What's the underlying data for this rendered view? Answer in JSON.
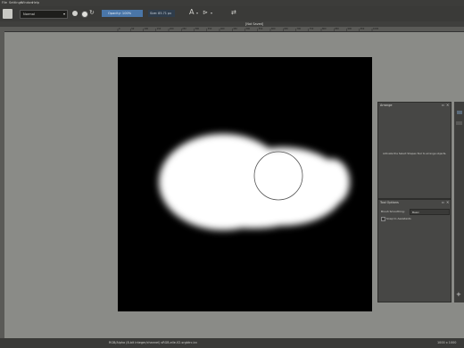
{
  "menubar": {
    "items": [
      "File",
      "Settings",
      "Window",
      "Help"
    ]
  },
  "toolbar": {
    "blend_mode": "Normal",
    "opacity": "Opacity: 100%",
    "size": "Size: 85.71 px"
  },
  "document": {
    "tab_title": "[Not Saved]"
  },
  "ruler_ticks": [
    "0",
    "50",
    "100",
    "150",
    "200",
    "250",
    "300",
    "350",
    "400",
    "450",
    "500",
    "550",
    "600",
    "650",
    "700",
    "750",
    "800",
    "850",
    "900",
    "950",
    "1000"
  ],
  "arrange_panel": {
    "title": "Arrange",
    "hint": "Activate the Select Shapes Tool to arrange objects."
  },
  "tool_options_panel": {
    "title": "Tool Options",
    "brush_smoothing_label": "Brush Smoothing:",
    "brush_smoothing_value": "Basic",
    "snap_label": "Snap to Assistants"
  },
  "statusbar": {
    "left": "RGB/Alpha (8-bit integer/channel)  sRGB-elle-V2-srgbtrc.icc",
    "right": "1000 x 1000"
  },
  "colors": {
    "canvas": "#000000",
    "background": "#8a8b87",
    "panel": "#474745"
  }
}
